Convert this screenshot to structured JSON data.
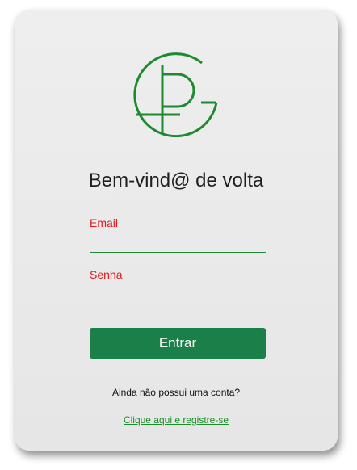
{
  "colors": {
    "accent": "#1b7f49",
    "logo": "#1e8a2f",
    "label": "#e4191c",
    "link": "#1a8f2a"
  },
  "login": {
    "title": "Bem-vind@ de volta",
    "email_label": "Email",
    "email_value": "",
    "password_label": "Senha",
    "password_value": "",
    "submit_label": "Entrar",
    "register_prompt": "Ainda não possui uma conta?",
    "register_link": "Clique aqui e registre-se"
  },
  "icons": {
    "logo": "pg-monogram-logo"
  }
}
